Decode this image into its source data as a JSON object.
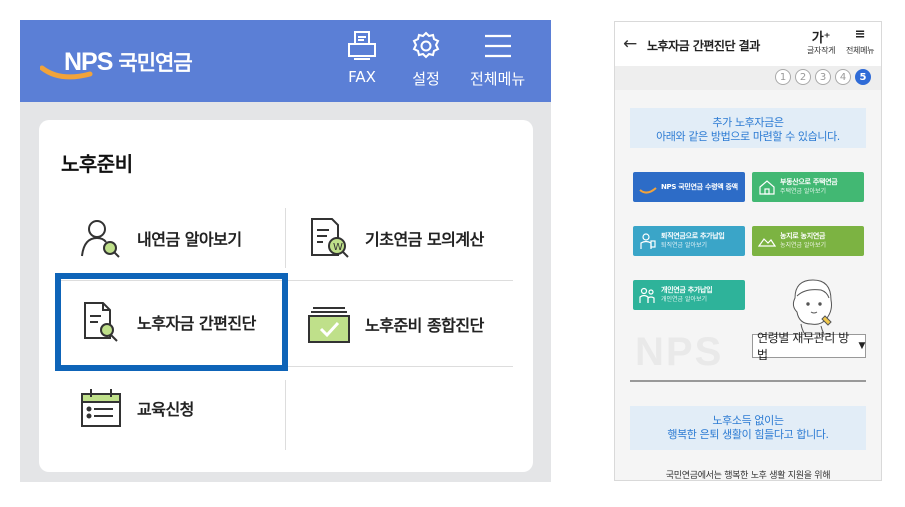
{
  "left": {
    "header": {
      "logo_text": "NPS",
      "logo_name": "국민연금",
      "buttons": [
        {
          "label": "FAX",
          "icon": "fax-icon"
        },
        {
          "label": "설정",
          "icon": "gear-icon"
        },
        {
          "label": "전체메뉴",
          "icon": "menu-icon"
        }
      ]
    },
    "card": {
      "title": "노후준비",
      "items": [
        {
          "label": "내연금 알아보기",
          "icon": "person-search-icon"
        },
        {
          "label": "기초연금 모의계산",
          "icon": "document-won-icon"
        },
        {
          "label": "노후자금 간편진단",
          "icon": "document-search-icon"
        },
        {
          "label": "노후준비 종합진단",
          "icon": "tray-check-icon"
        },
        {
          "label": "교육신청",
          "icon": "calendar-list-icon"
        }
      ]
    },
    "colors": {
      "header": "#5b7fd6",
      "highlight": "#0e64b8",
      "logo_swoosh": "#f2a33a"
    }
  },
  "right": {
    "title": "노후자금 간편진단 결과",
    "tools": [
      {
        "glyph": "가⁺",
        "label": "글자작게"
      },
      {
        "glyph": "≡",
        "label": "전체메뉴"
      }
    ],
    "steps": [
      "1",
      "2",
      "3",
      "4",
      "5"
    ],
    "active_step": "5",
    "banner1": {
      "line1": "추가 노후자금은",
      "line2": "아래와 같은 방법으로 마련할 수 있습니다."
    },
    "options": [
      {
        "title": "NPS 국민연금 수령액 증액",
        "sub": "",
        "color": "#2d6cc7",
        "icon": "nps-logo-icon"
      },
      {
        "title": "부동산으로 주택연금",
        "sub": "주택연금 알아보기",
        "color": "#42b873",
        "icon": "house-icon"
      },
      {
        "title": "퇴직연금으로 추가납입",
        "sub": "퇴직연금 알아보기",
        "color": "#3aa5c8",
        "icon": "worker-icon"
      },
      {
        "title": "농지로 농지연금",
        "sub": "농지연금 알아보기",
        "color": "#7cb342",
        "icon": "farm-icon"
      },
      {
        "title": "개인연금 추가납입",
        "sub": "개인연금 알아보기",
        "color": "#2eb39a",
        "icon": "family-icon"
      }
    ],
    "watermark": "NPS",
    "select_label": "연령별 재무관리 방법",
    "banner2": {
      "line1": "노후소득 없이는",
      "line2": "행복한 은퇴 생활이 힘들다고 합니다."
    },
    "bottom_text": "국민연금에서는 행복한 노후 생활 지원을 위해",
    "colors": {
      "step_active": "#2f6bd7",
      "banner_bg": "#e2edf7",
      "banner_text": "#2c7bd3"
    }
  }
}
